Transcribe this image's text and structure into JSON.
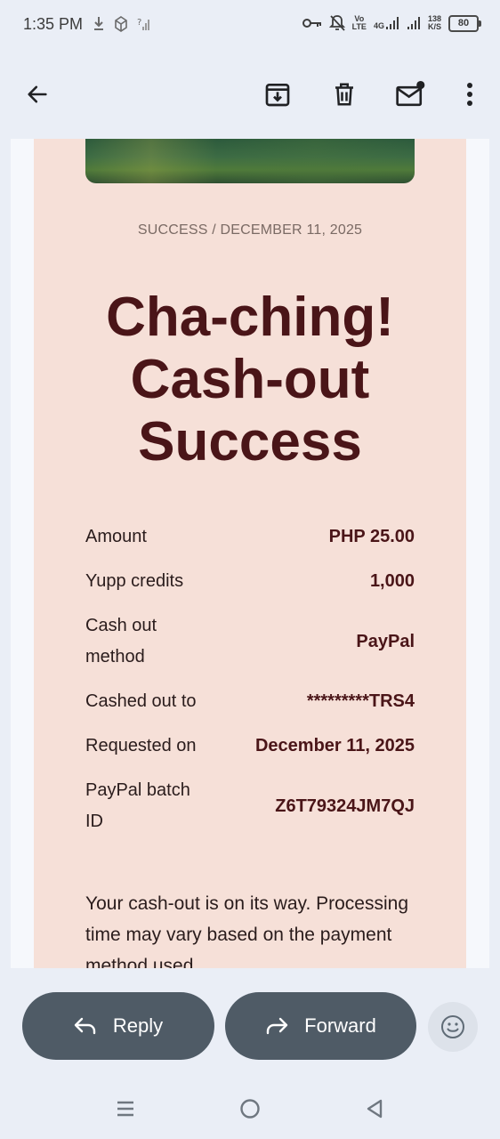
{
  "status_bar": {
    "time": "1:35 PM",
    "net_line1": "Vo",
    "net_line2": "LTE",
    "net_gen": "4G",
    "speed_value": "138",
    "speed_unit": "K/S",
    "battery": "80"
  },
  "toolbar": {
    "icons": [
      "back-arrow-icon",
      "archive-icon",
      "delete-icon",
      "mark-unread-icon",
      "more-vert-icon"
    ]
  },
  "email": {
    "meta": "SUCCESS / DECEMBER 11, 2025",
    "headline_line1": "Cha-ching!",
    "headline_line2": "Cash-out",
    "headline_line3": "Success",
    "details": [
      {
        "label": "Amount",
        "value": "PHP 25.00"
      },
      {
        "label": "Yupp credits",
        "value": "1,000"
      },
      {
        "label": "Cash out method",
        "value": "PayPal"
      },
      {
        "label": "Cashed out to",
        "value": "*********TRS4"
      },
      {
        "label": "Requested on",
        "value": "December 11, 2025"
      },
      {
        "label": "PayPal batch ID",
        "value": "Z6T79324JM7QJ"
      }
    ],
    "body": "Your cash-out is on its way. Processing time may vary based on the payment method used."
  },
  "actions": {
    "reply_label": "Reply",
    "forward_label": "Forward"
  },
  "colors": {
    "card_bg": "#f6e0d8",
    "headline": "#4a1518",
    "button_bg": "#4f5b66"
  }
}
